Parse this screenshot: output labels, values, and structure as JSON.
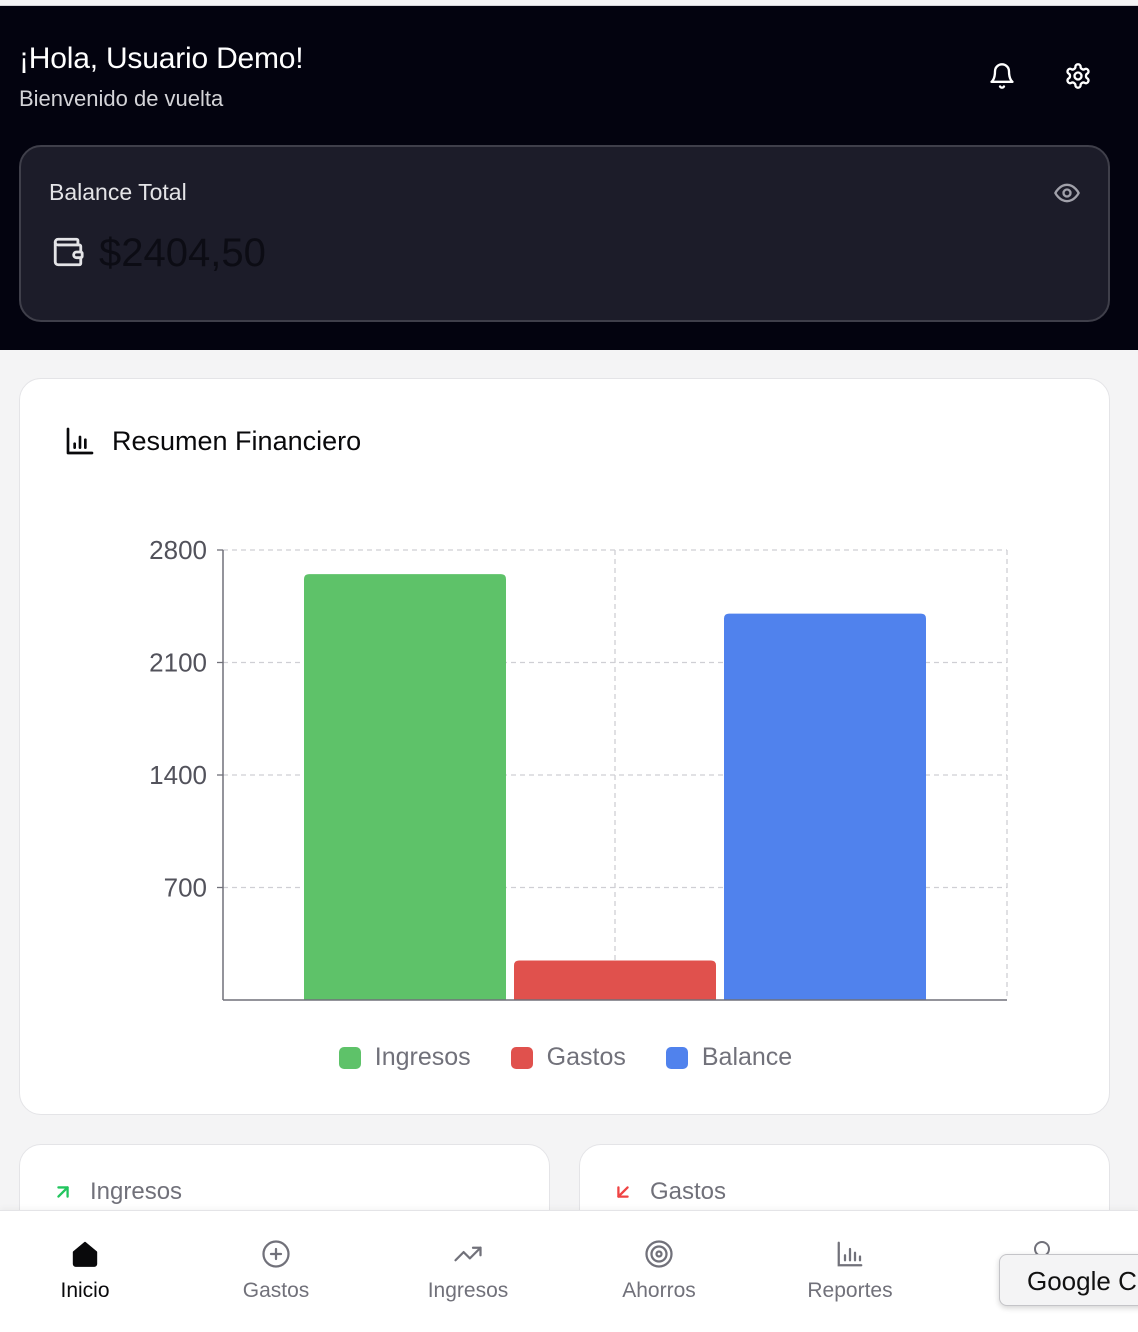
{
  "header": {
    "greeting": "¡Hola, Usuario Demo!",
    "subtitle": "Bienvenido de vuelta",
    "notifications_icon": "bell-icon",
    "settings_icon": "gear-icon"
  },
  "balance": {
    "label": "Balance Total",
    "amount": "$2404,50",
    "visibility_icon": "eye-icon",
    "wallet_icon": "wallet-icon"
  },
  "summary": {
    "title": "Resumen Financiero",
    "icon": "bar-chart-icon"
  },
  "chart_data": {
    "type": "bar",
    "categories": [
      "Ingresos",
      "Gastos",
      "Balance"
    ],
    "series": [
      {
        "name": "Ingresos",
        "values": [
          2650,
          null,
          null
        ],
        "color": "#5ec269"
      },
      {
        "name": "Gastos",
        "values": [
          null,
          245.5,
          null
        ],
        "color": "#e0514d"
      },
      {
        "name": "Balance",
        "values": [
          null,
          null,
          2404.5
        ],
        "color": "#5082ed"
      }
    ],
    "yticks": [
      "700",
      "1400",
      "2100",
      "2800"
    ],
    "ylim": [
      0,
      2800
    ],
    "grid": true,
    "legend_position": "bottom"
  },
  "stats": [
    {
      "label": "Ingresos",
      "icon": "arrow-up-right-icon",
      "color": "#22c55e"
    },
    {
      "label": "Gastos",
      "icon": "arrow-down-left-icon",
      "color": "#ef4444"
    }
  ],
  "nav": {
    "items": [
      {
        "label": "Inicio",
        "icon": "home-icon",
        "active": true
      },
      {
        "label": "Gastos",
        "icon": "plus-circle-icon",
        "active": false
      },
      {
        "label": "Ingresos",
        "icon": "trending-up-icon",
        "active": false
      },
      {
        "label": "Ahorros",
        "icon": "target-icon",
        "active": false
      },
      {
        "label": "Reportes",
        "icon": "bar-chart-icon",
        "active": false
      }
    ]
  },
  "tooltip": {
    "text": "Google C"
  },
  "colors": {
    "header_bg": "#03030f",
    "card_bg": "#1c1c29",
    "ingresos": "#5ec269",
    "gastos": "#e0514d",
    "balance": "#5082ed"
  }
}
